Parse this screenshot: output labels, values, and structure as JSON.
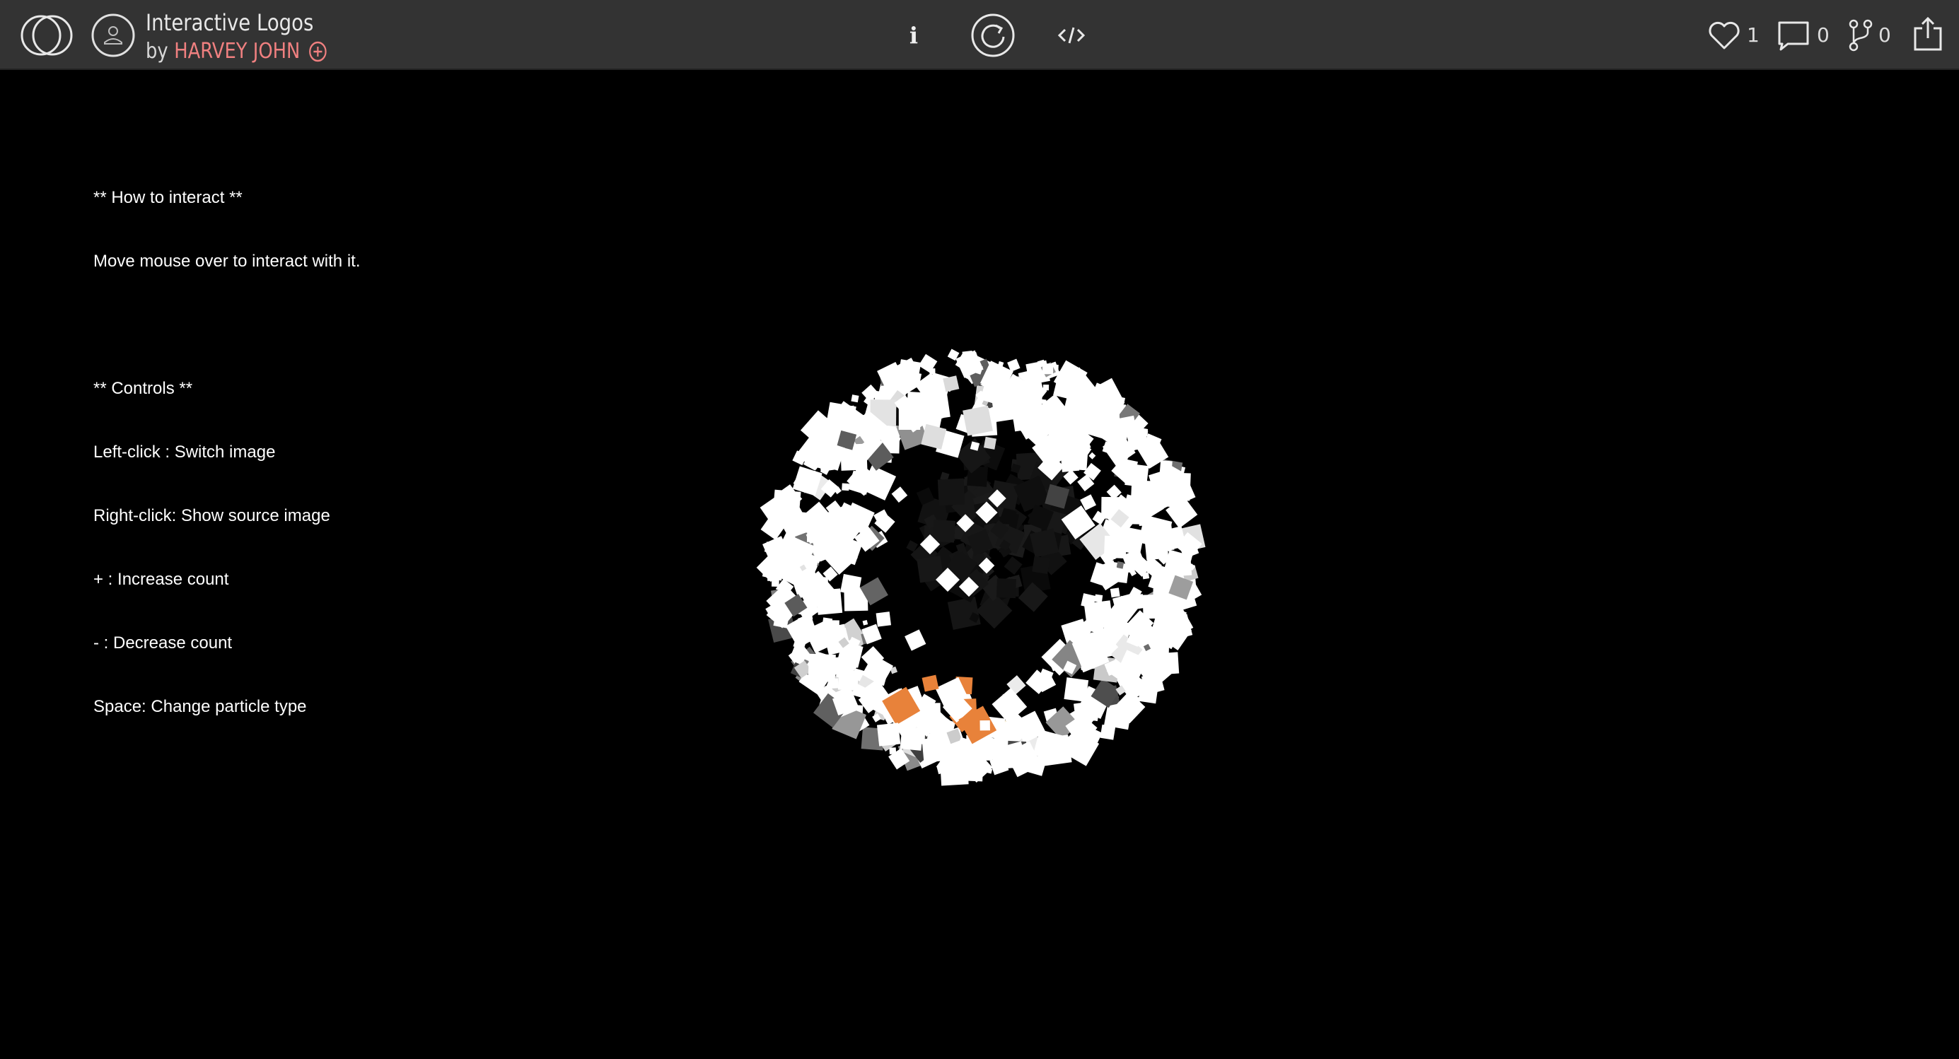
{
  "header": {
    "title": "Interactive Logos",
    "by_label": "by",
    "author": "HARVEY JOHN",
    "info_label": "i",
    "likes": "1",
    "comments": "0",
    "forks": "0"
  },
  "colors": {
    "topbar": "#333333",
    "author_accent": "#f08080",
    "canvas_bg": "#000000",
    "particle_primary": "#ffffff",
    "particle_accent": "#e8823a"
  },
  "instructions": {
    "lines": [
      "** How to interact **",
      "Move mouse over to interact with it.",
      "",
      "** Controls **",
      "Left-click : Switch image",
      "Right-click: Show source image",
      "+ : Increase count",
      "- : Decrease count",
      "Space: Change particle type"
    ]
  }
}
